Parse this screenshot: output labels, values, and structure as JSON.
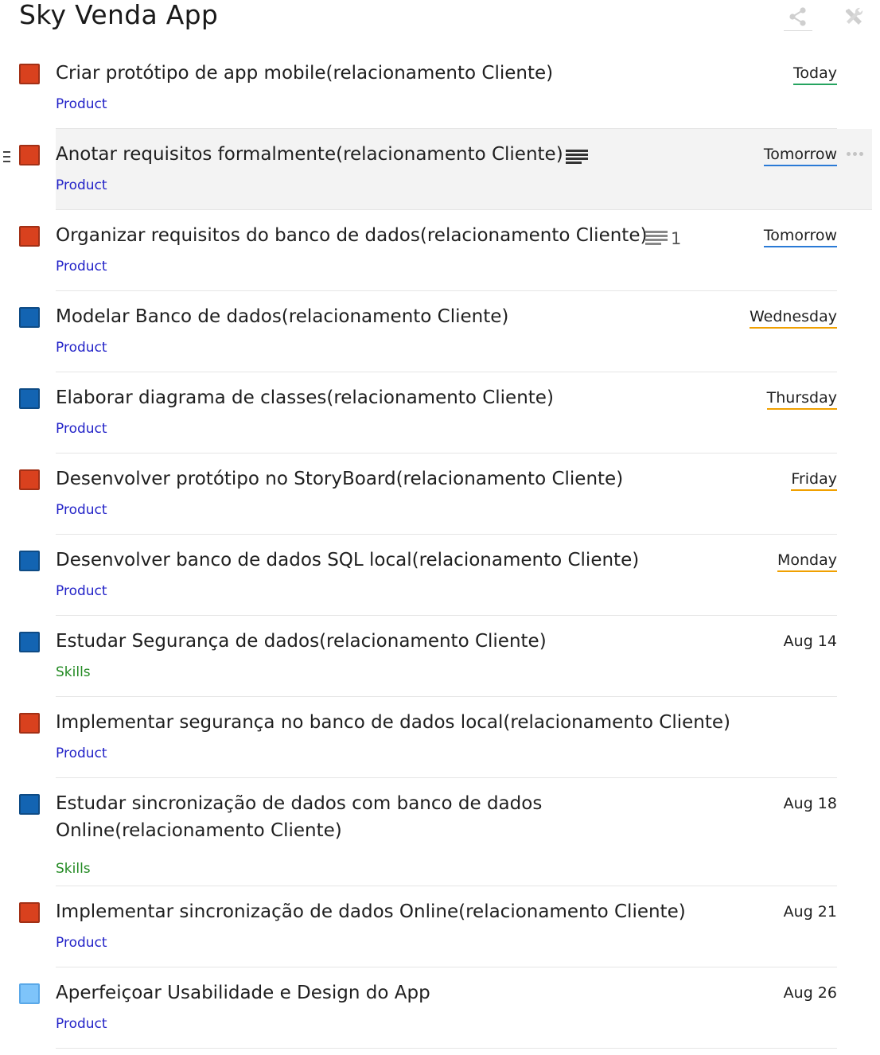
{
  "app": {
    "title": "Sky Venda App"
  },
  "header": {
    "share_icon": "share-icon",
    "tools_icon": "tools-icon"
  },
  "colors": {
    "priority_high": "#d9411e",
    "priority_medium": "#1364b2",
    "priority_low": "#7ec4fa",
    "project_product": "#2323c8",
    "project_skills": "#238a23",
    "due_today": "#25a35f",
    "due_tomorrow": "#2a7ad6",
    "due_week": "#f0a000"
  },
  "tasks": [
    {
      "title": "Criar protótipo de app mobile(relacionamento Cliente)",
      "project": "Product",
      "due": "Today",
      "priority": "high",
      "due_style": "today"
    },
    {
      "title": "Anotar requisitos formalmente(relacionamento Cliente)",
      "project": "Product",
      "due": "Tomorrow",
      "priority": "high",
      "due_style": "tomorrow",
      "has_note": true
    },
    {
      "title": "Organizar requisitos do banco de dados(relacionamento Cliente)",
      "project": "Product",
      "due": "Tomorrow",
      "priority": "high",
      "due_style": "tomorrow",
      "comments": "1"
    },
    {
      "title": "Modelar Banco de dados(relacionamento Cliente)",
      "project": "Product",
      "due": "Wednesday",
      "priority": "medium",
      "due_style": "week"
    },
    {
      "title": "Elaborar diagrama de classes(relacionamento Cliente)",
      "project": "Product",
      "due": "Thursday",
      "priority": "medium",
      "due_style": "week"
    },
    {
      "title": "Desenvolver protótipo no StoryBoard(relacionamento Cliente)",
      "project": "Product",
      "due": "Friday",
      "priority": "high",
      "due_style": "week"
    },
    {
      "title": "Desenvolver banco de dados SQL local(relacionamento Cliente)",
      "project": "Product",
      "due": "Monday",
      "priority": "medium",
      "due_style": "week"
    },
    {
      "title": "Estudar Segurança de dados(relacionamento Cliente)",
      "project": "Skills",
      "due": "Aug 14",
      "priority": "medium",
      "due_style": "none"
    },
    {
      "title": "Implementar segurança no banco de dados local(relacionamento Cliente)",
      "project": "Product",
      "due": "",
      "priority": "high",
      "due_style": "none"
    },
    {
      "title": "Estudar sincronização de dados com banco de dados Online(relacionamento Cliente)",
      "project": "Skills",
      "due": "Aug 18",
      "priority": "medium",
      "due_style": "none"
    },
    {
      "title": "Implementar sincronização de dados Online(relacionamento Cliente)",
      "project": "Product",
      "due": "Aug 21",
      "priority": "high",
      "due_style": "none"
    },
    {
      "title": "Aperfeiçoar Usabilidade e Design do App",
      "project": "Product",
      "due": "Aug 26",
      "priority": "low",
      "due_style": "none"
    }
  ]
}
